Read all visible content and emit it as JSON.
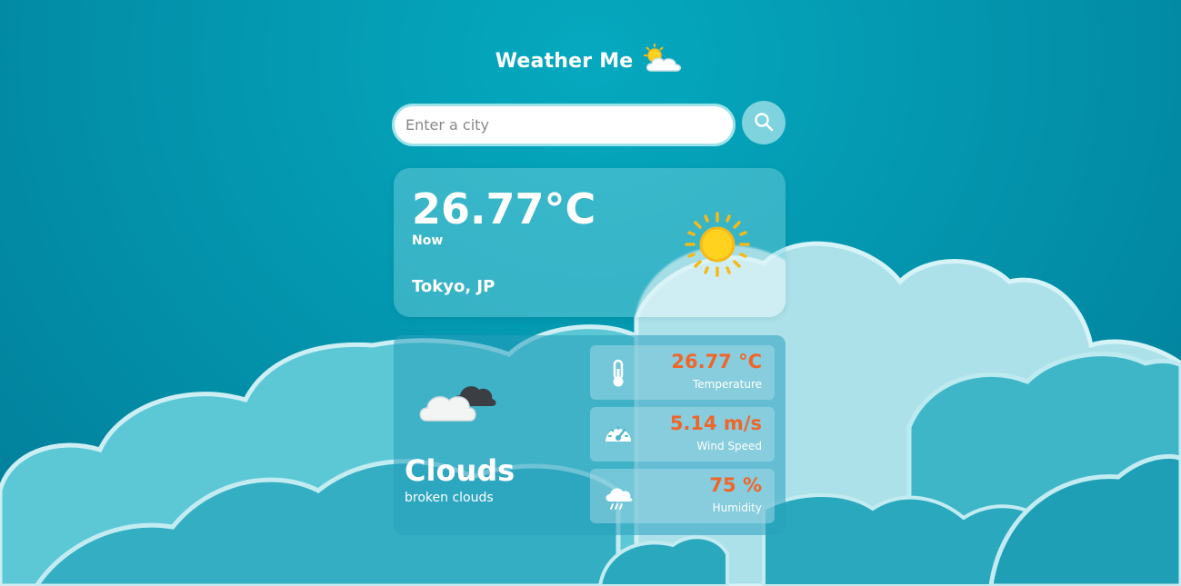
{
  "header": {
    "title": "Weather Me",
    "icon": "sun-behind-cloud-icon"
  },
  "search": {
    "placeholder": "Enter a city",
    "value": "",
    "button_icon": "search-icon"
  },
  "current": {
    "temperature": "26.77°C",
    "time_label": "Now",
    "location": "Tokyo, JP",
    "icon": "sun-icon"
  },
  "details": {
    "condition": "Clouds",
    "description": "broken clouds",
    "icon": "broken-clouds-icon",
    "stats": [
      {
        "icon": "thermometer-icon",
        "value": "26.77 °C",
        "label": "Temperature"
      },
      {
        "icon": "speedometer-icon",
        "value": "5.14 m/s",
        "label": "Wind Speed"
      },
      {
        "icon": "rain-cloud-icon",
        "value": "75 %",
        "label": "Humidity"
      }
    ]
  },
  "colors": {
    "background": "#0396ae",
    "accent_value": "#f0652a",
    "search_button": "#7fd3df"
  }
}
